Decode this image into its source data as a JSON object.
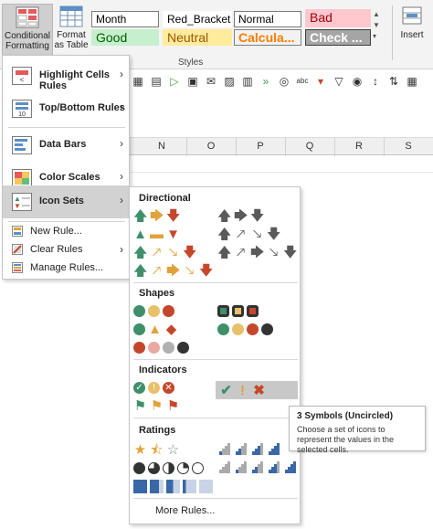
{
  "ribbon": {
    "conditional_formatting": "Conditional Formatting",
    "format_as_table": "Format as Table",
    "insert": "Insert",
    "styles_group_label": "Styles",
    "styles": [
      {
        "label": "Month",
        "bg": "#ffffff",
        "color": "#000000",
        "border": "#7a7a7a"
      },
      {
        "label": "Red_Brackets",
        "bg": "#ffffff",
        "color": "#000000",
        "border": "#ffffff"
      },
      {
        "label": "Normal",
        "bg": "#ffffff",
        "color": "#000000",
        "border": "#7a7a7a"
      },
      {
        "label": "Bad",
        "bg": "#ffc7ce",
        "color": "#9c0006",
        "border": "#ffc7ce"
      },
      {
        "label": "Good",
        "bg": "#c6efce",
        "color": "#006100",
        "border": "#c6efce"
      },
      {
        "label": "Neutral",
        "bg": "#ffeb9c",
        "color": "#9c5700",
        "border": "#ffeb9c"
      },
      {
        "label": "Calcula...",
        "bg": "#f2f2f2",
        "color": "#fa7d00",
        "border": "#7f7f7f"
      },
      {
        "label": "Check ...",
        "bg": "#a5a5a5",
        "color": "#ffffff",
        "border": "#3f3f3f"
      }
    ]
  },
  "columns": [
    "N",
    "O",
    "P",
    "Q",
    "R",
    "S"
  ],
  "cf_menu": {
    "items": [
      {
        "label": "Highlight Cells Rules",
        "icon": "highlight-cells-icon"
      },
      {
        "label": "Top/Bottom Rules",
        "icon": "top-bottom-icon"
      },
      {
        "label": "Data Bars",
        "icon": "data-bars-icon"
      },
      {
        "label": "Color Scales",
        "icon": "color-scales-icon"
      },
      {
        "label": "Icon Sets",
        "icon": "icon-sets-icon"
      }
    ],
    "new_rule": "New Rule...",
    "clear_rules": "Clear Rules",
    "manage_rules": "Manage Rules..."
  },
  "icon_sets": {
    "directional": "Directional",
    "shapes": "Shapes",
    "indicators": "Indicators",
    "ratings": "Ratings",
    "more_rules": "More Rules..."
  },
  "tooltip": {
    "title": "3 Symbols (Uncircled)",
    "body": "Choose a set of icons to represent the values in the selected cells."
  },
  "colors": {
    "green": "#3f8f6b",
    "amber": "#e0a23b",
    "red": "#c5472b",
    "menu_selected": "#d2d2d2"
  }
}
